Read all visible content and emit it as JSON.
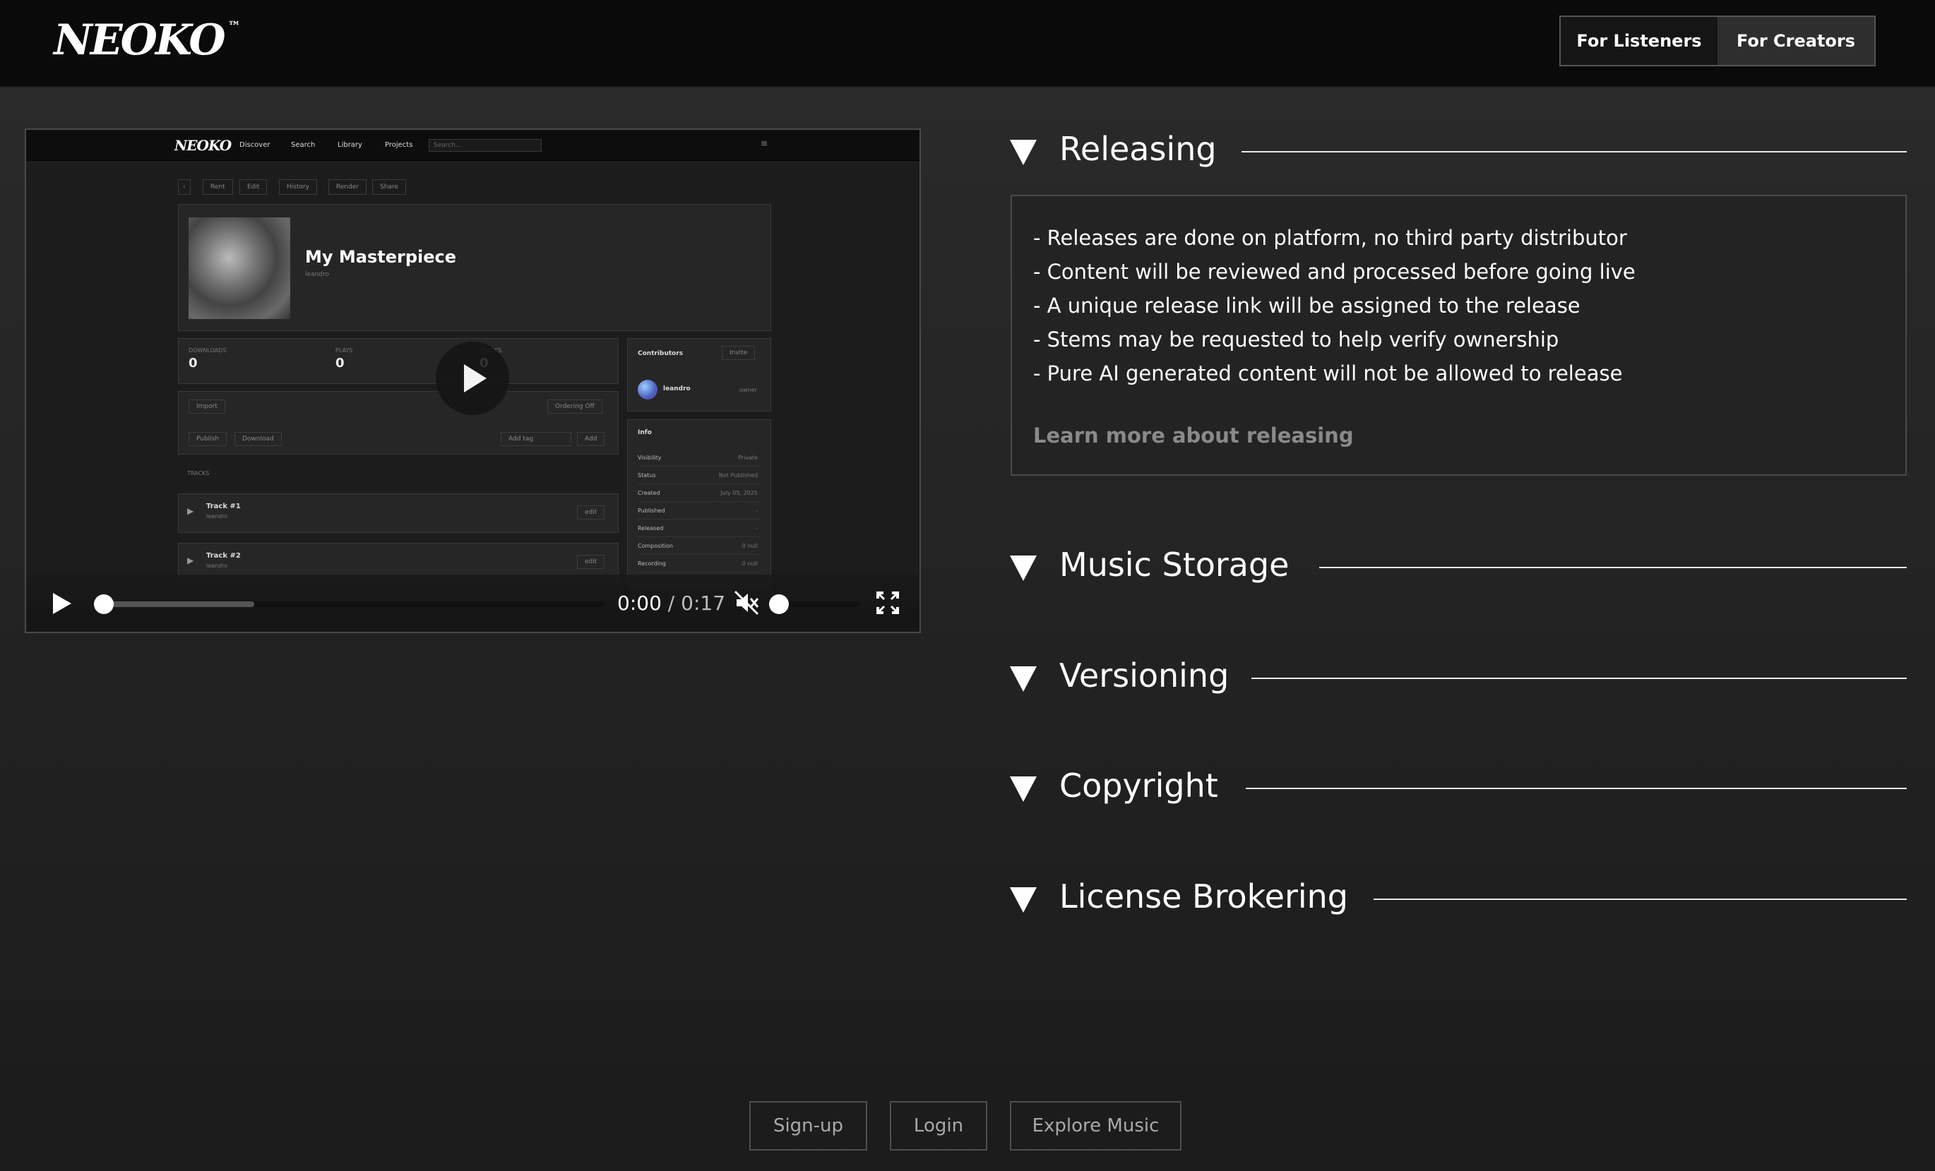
{
  "header": {
    "logo_text": "NEOKO",
    "logo_tm": "™",
    "audience_tabs": [
      {
        "label": "For Listeners",
        "active": true
      },
      {
        "label": "For Creators",
        "active": false
      }
    ]
  },
  "video": {
    "screenshot": {
      "logo": "NEOKO",
      "nav": [
        "Discover",
        "Search",
        "Library",
        "Projects"
      ],
      "search_placeholder": "Search...",
      "toolbar": [
        "Rent",
        "Edit",
        "History",
        "Render",
        "Share"
      ],
      "project_title": "My Masterpiece",
      "project_owner": "leandro",
      "stats": [
        {
          "label": "DOWNLOADS",
          "value": "0"
        },
        {
          "label": "PLAYS",
          "value": "0"
        },
        {
          "label": "TRACKS",
          "value": "0"
        }
      ],
      "actions": [
        "Import",
        "Ordering Off",
        "Publish",
        "Download",
        "Add tag",
        "Add"
      ],
      "tracks_label": "TRACKS",
      "tracks": [
        {
          "name": "Track #1",
          "owner": "leandro",
          "action": "edit"
        },
        {
          "name": "Track #2",
          "owner": "leandro",
          "action": "edit"
        }
      ],
      "contributors": {
        "title": "Contributors",
        "invite": "Invite",
        "user": "leandro",
        "role": "owner"
      },
      "info": {
        "title": "Info",
        "rows": [
          {
            "k": "Visibility",
            "v": "Private"
          },
          {
            "k": "Status",
            "v": "Not Published"
          },
          {
            "k": "Created",
            "v": "July 05, 2025"
          },
          {
            "k": "Published",
            "v": "-"
          },
          {
            "k": "Released",
            "v": "-"
          },
          {
            "k": "Composition",
            "v": "0 null"
          },
          {
            "k": "Recording",
            "v": "0 null"
          }
        ]
      }
    },
    "player": {
      "current_time": "0:00",
      "separator": "/",
      "duration": "0:17",
      "progress_fraction": 0,
      "buffered_fraction": 0.3,
      "volume_fraction": 0,
      "muted": true,
      "icons": [
        "play-icon",
        "mute-icon",
        "fullscreen-icon"
      ]
    }
  },
  "accordion": [
    {
      "title": "Releasing",
      "expanded": true,
      "items": [
        "- Releases are done on platform, no third party distributor",
        "- Content will be reviewed and processed before going live",
        "- A unique release link will be assigned to the release",
        "- Stems may be requested to help verify ownership",
        "- Pure AI generated content will not be allowed to release"
      ],
      "link": "Learn more about releasing"
    },
    {
      "title": "Music Storage",
      "expanded": false
    },
    {
      "title": "Versioning",
      "expanded": false
    },
    {
      "title": "Copyright",
      "expanded": false
    },
    {
      "title": "License Brokering",
      "expanded": false
    }
  ],
  "footer": {
    "buttons": [
      "Sign-up",
      "Login",
      "Explore Music"
    ]
  }
}
